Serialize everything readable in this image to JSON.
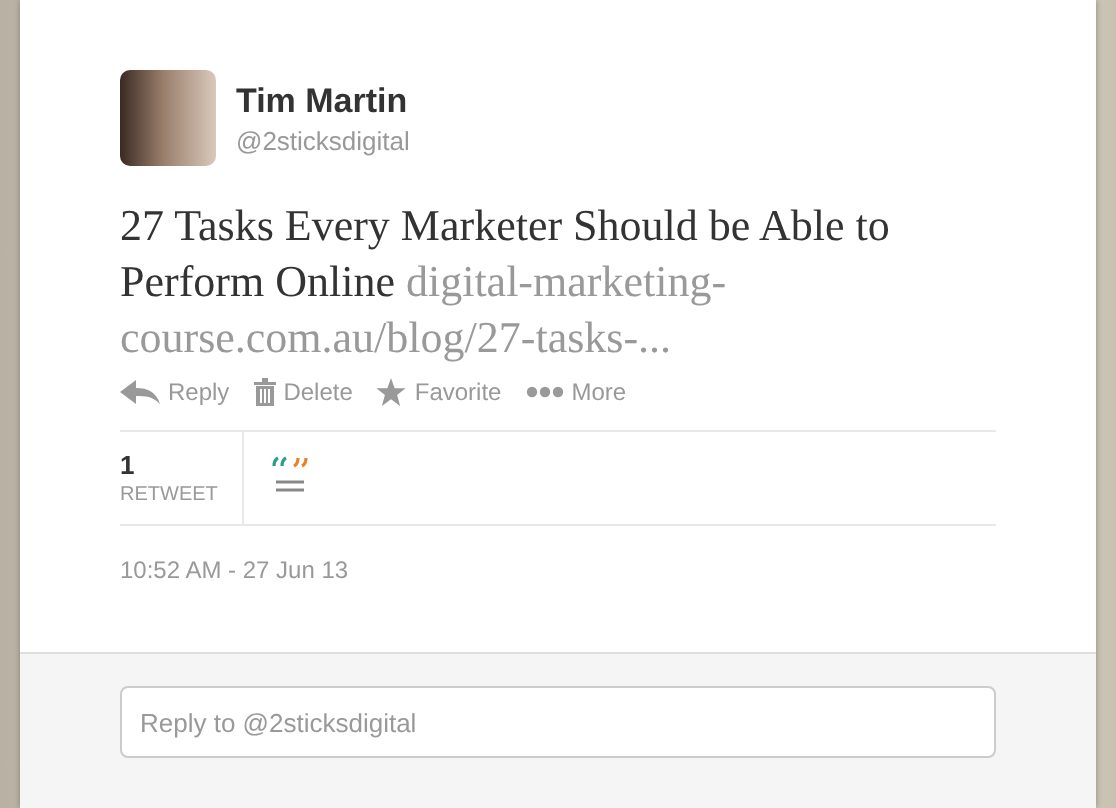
{
  "author": {
    "name": "Tim Martin",
    "handle": "@2sticksdigital"
  },
  "tweet": {
    "text": "27 Tasks Every Marketer Should be Able to Perform Online",
    "link_lines": [
      "digital-marketing-",
      "course.com.au/blog/27-tasks-..."
    ]
  },
  "actions": [
    {
      "kind": "reply",
      "label": "Reply"
    },
    {
      "kind": "delete",
      "label": "Delete"
    },
    {
      "kind": "favorite",
      "label": "Favorite"
    },
    {
      "kind": "more",
      "label": "More"
    }
  ],
  "stats": {
    "count": "1",
    "label": "RETWEET"
  },
  "timestamp": "10:52 AM - 27 Jun 13",
  "reply_box": {
    "placeholder": "Reply to @2sticksdigital"
  }
}
